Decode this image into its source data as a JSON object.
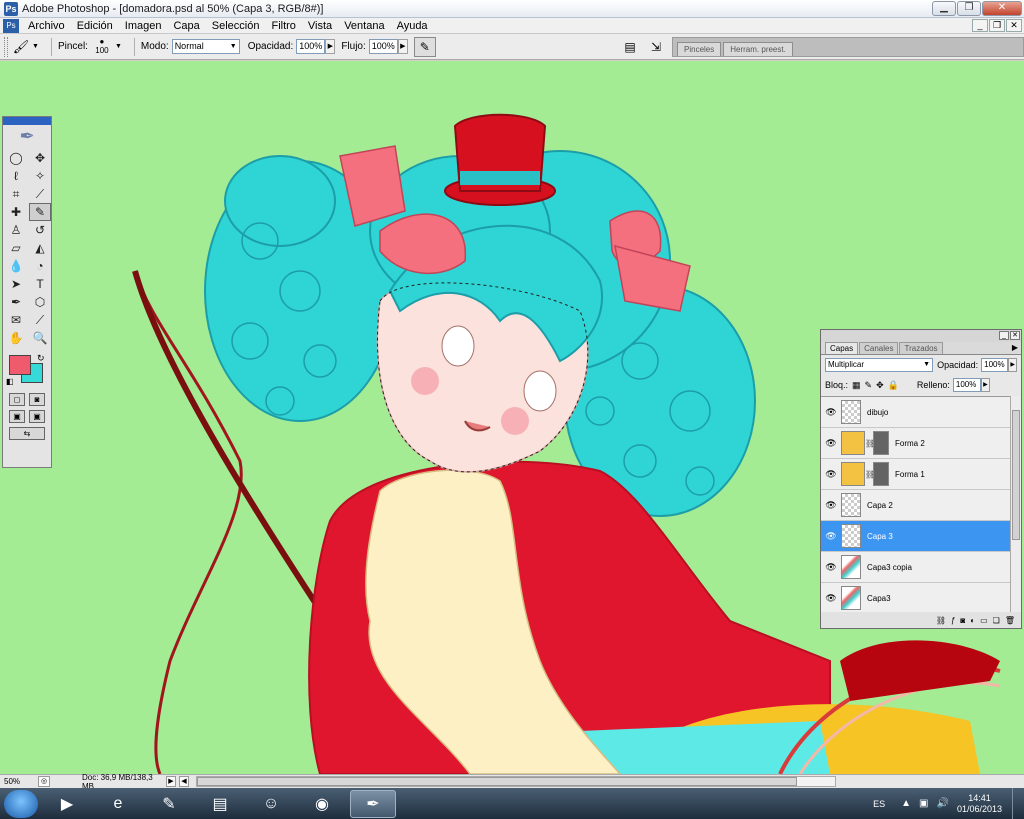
{
  "window": {
    "title": "Adobe Photoshop - [domadora.psd al 50% (Capa 3, RGB/8#)]",
    "app_icon": "Ps",
    "buttons": [
      "minimize-icon",
      "restore-icon",
      "close-icon"
    ]
  },
  "menu": {
    "items": [
      "Archivo",
      "Edición",
      "Imagen",
      "Capa",
      "Selección",
      "Filtro",
      "Vista",
      "Ventana",
      "Ayuda"
    ]
  },
  "options": {
    "brush_label": "Pincel:",
    "brush_size": "100",
    "mode_label": "Modo:",
    "mode_value": "Normal",
    "opacity_label": "Opacidad:",
    "opacity_value": "100%",
    "flow_label": "Flujo:",
    "flow_value": "100%",
    "well_tabs": [
      "Pinceles",
      "Herram. preest."
    ]
  },
  "tools": {
    "foreground_color": "#f05a6d",
    "background_color": "#35d9d8"
  },
  "layers": {
    "tabs": [
      "Capas",
      "Canales",
      "Trazados"
    ],
    "blend_mode": "Multiplicar",
    "opacity_label": "Opacidad:",
    "opacity_value": "100%",
    "lock_label": "Bloq.:",
    "fill_label": "Relleno:",
    "fill_value": "100%",
    "items": [
      {
        "name": "dibujo"
      },
      {
        "name": "Forma 2"
      },
      {
        "name": "Forma 1"
      },
      {
        "name": "Capa 2"
      },
      {
        "name": "Capa 3"
      },
      {
        "name": "Capa3 copia"
      },
      {
        "name": "Capa3"
      }
    ]
  },
  "status": {
    "zoom": "50%",
    "doc": "Doc: 36,9 MB/138,3 MB"
  },
  "taskbar": {
    "language": "ES",
    "time": "14:41",
    "date": "01/06/2013"
  },
  "colors": {
    "canvas_bg": "#a3ec94",
    "selected_layer": "#3d95f2"
  }
}
